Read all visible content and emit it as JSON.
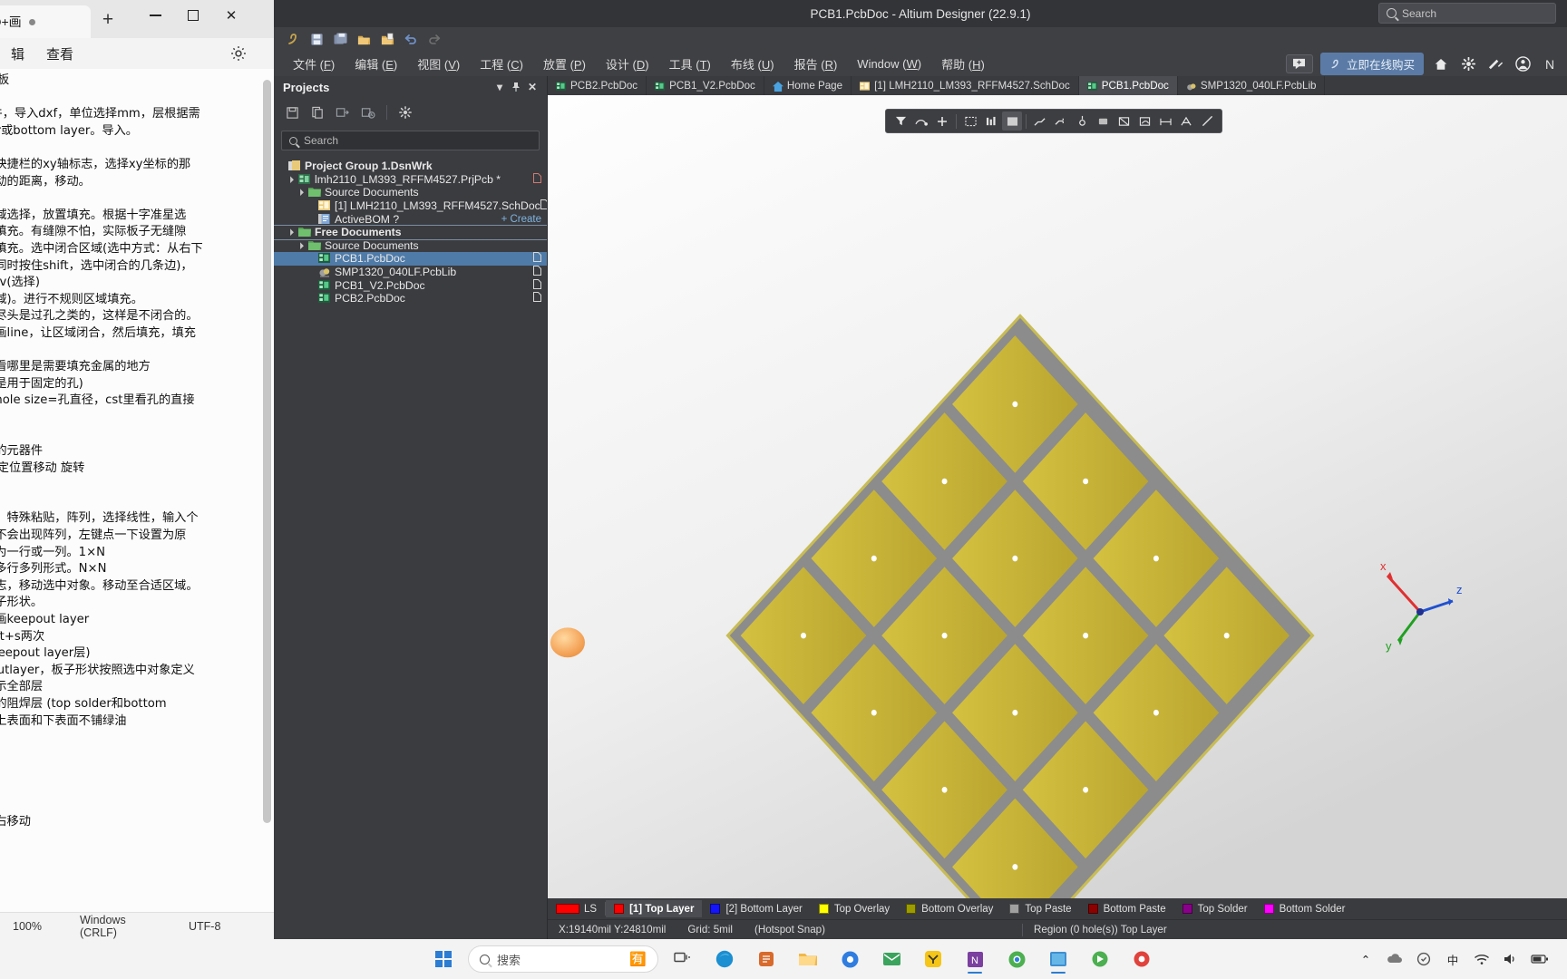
{
  "editor": {
    "tab_title": "入AD+画",
    "new_tab_label": "+",
    "window_buttons": {
      "minimize": "—",
      "maximize": "▢",
      "close": "✕"
    },
    "menus": [
      "辑",
      "查看"
    ],
    "gear_icon": "gear-icon",
    "content": "emo板\n\nb文件，导入dxf，单位选择mm，层根据需\nlayer或bottom layer。导入。\n\n上方快捷栏的xy轴标志，选择xy坐标的那\n要移动的距离，移动。\n\n则区域选择，放置填充。根据十字准星选\n点，填充。有缝隙不怕，实际板子无缝隙\n区域填充。选中闭合区域(选中方式：从右下\n边，同时按住shift，选中闭合的几条边)，\n具)＋v(选择)\n择区域)。进行不规则区域填充。\n区域尽头是过孔之类的，这样是不闭合的。\n孔，画line，让区域闭合，然后填充，填充\n孔。\n井，看哪里是需要填充金属的地方\n一般是用于固定的孔)\n孔，hole size=孔直径，cst里看孔的直接\n\n\n要加的元器件\nxy固定位置移动 旋转\n\n\n编辑，特殊粘贴，阵列，选择线性，输入个\n离。不会出现阵列，左键点一下设置为原\n列，为一行或一列。1×N\n生成多行多列形式。N×N\n动标志，移动选中对象。移动至合适区域。\n置板子形状。\n边缘画keepout layer\n  shift+s两次\n层 (keepout layer层)\nep outlayer，板子形状按照选中对象定义\n，显示全部层\n底层的阻焊层 (top solder和bottom\n使得上表面和下表面不铺绿油\n\n\n\n移动\n\n：左右移动\n放大",
    "status": {
      "zoom": "100%",
      "line_ending": "Windows (CRLF)",
      "encoding": "UTF-8"
    }
  },
  "altium": {
    "title": "PCB1.PcbDoc - Altium Designer (22.9.1)",
    "search_placeholder": "Search",
    "quick_toolbar": [
      "altium-logo-icon",
      "save-icon",
      "save-all-icon",
      "open-icon",
      "open-project-icon",
      "undo-icon",
      "redo-icon"
    ],
    "menus": [
      {
        "label": "文件",
        "accel": "F"
      },
      {
        "label": "编辑",
        "accel": "E"
      },
      {
        "label": "视图",
        "accel": "V"
      },
      {
        "label": "工程",
        "accel": "C"
      },
      {
        "label": "放置",
        "accel": "P"
      },
      {
        "label": "设计",
        "accel": "D"
      },
      {
        "label": "工具",
        "accel": "T"
      },
      {
        "label": "布线",
        "accel": "U"
      },
      {
        "label": "报告",
        "accel": "R"
      },
      {
        "label": "Window",
        "accel": "W"
      },
      {
        "label": "帮助",
        "accel": "H"
      }
    ],
    "buy_button": "立即在线购买",
    "right_icons": [
      "chat-icon",
      "home-icon",
      "gear-icon",
      "notifications-icon",
      "account-icon",
      "menu-icon"
    ],
    "projects_panel": {
      "title": "Projects",
      "header_buttons": [
        "chevron-down-icon",
        "pin-icon",
        "close-icon"
      ],
      "toolbar_icons": [
        "save-icon",
        "copy-icon",
        "compile-icon",
        "history-icon",
        "settings-icon"
      ],
      "search_placeholder": "Search",
      "tree": [
        {
          "indent": 0,
          "arrow": "",
          "icon": "workspace-icon",
          "label": "Project Group 1.DsnWrk",
          "right": "",
          "bold": true,
          "selected": false,
          "boxed": false
        },
        {
          "indent": 1,
          "arrow": "▲",
          "icon": "pcb-project-icon",
          "label": "lmh2110_LM393_RFFM4527.PrjPcb *",
          "right": "doc-red",
          "bold": false,
          "selected": false,
          "boxed": false
        },
        {
          "indent": 2,
          "arrow": "▲",
          "icon": "folder-icon",
          "label": "Source Documents",
          "right": "",
          "bold": false,
          "selected": false,
          "boxed": false
        },
        {
          "indent": 3,
          "arrow": "",
          "icon": "sch-icon",
          "label": "[1] LMH2110_LM393_RFFM4527.SchDoc",
          "right": "doc",
          "bold": false,
          "selected": false,
          "boxed": false
        },
        {
          "indent": 3,
          "arrow": "",
          "icon": "bom-icon",
          "label": "ActiveBOM ?",
          "right": "+ Create",
          "bold": false,
          "selected": false,
          "boxed": false
        },
        {
          "indent": 1,
          "arrow": "▲",
          "icon": "folder-icon",
          "label": "Free Documents",
          "right": "",
          "bold": true,
          "selected": false,
          "boxed": true
        },
        {
          "indent": 2,
          "arrow": "▲",
          "icon": "folder-icon",
          "label": "Source Documents",
          "right": "",
          "bold": false,
          "selected": false,
          "boxed": false
        },
        {
          "indent": 3,
          "arrow": "",
          "icon": "pcb-icon",
          "label": "PCB1.PcbDoc",
          "right": "doc",
          "bold": false,
          "selected": true,
          "boxed": false
        },
        {
          "indent": 3,
          "arrow": "",
          "icon": "pcblib-icon",
          "label": "SMP1320_040LF.PcbLib",
          "right": "doc",
          "bold": false,
          "selected": false,
          "boxed": false
        },
        {
          "indent": 3,
          "arrow": "",
          "icon": "pcb-icon",
          "label": "PCB1_V2.PcbDoc",
          "right": "doc",
          "bold": false,
          "selected": false,
          "boxed": false
        },
        {
          "indent": 3,
          "arrow": "",
          "icon": "pcb-icon",
          "label": "PCB2.PcbDoc",
          "right": "doc",
          "bold": false,
          "selected": false,
          "boxed": false
        }
      ]
    },
    "doc_tabs": [
      {
        "label": "PCB2.PcbDoc",
        "icon": "pcb-icon",
        "active": false
      },
      {
        "label": "PCB1_V2.PcbDoc",
        "icon": "pcb-icon",
        "active": false
      },
      {
        "label": "Home Page",
        "icon": "home-icon",
        "active": false
      },
      {
        "label": "[1] LMH2110_LM393_RFFM4527.SchDoc",
        "icon": "sch-icon",
        "active": false
      },
      {
        "label": "PCB1.PcbDoc",
        "icon": "pcb-icon",
        "active": true
      },
      {
        "label": "SMP1320_040LF.PcbLib",
        "icon": "pcblib-icon",
        "active": false
      }
    ],
    "float_toolbar": [
      "filter-icon",
      "net-icon",
      "add-icon",
      "select-rect-icon",
      "align-icon",
      "fill-icon",
      "route-icon",
      "via-icon",
      "component-icon",
      "polygon-icon",
      "arc-icon",
      "dimension-icon",
      "text-icon",
      "line-icon"
    ],
    "layers": [
      {
        "label": "LS",
        "color": "#ff0000",
        "active": false,
        "isLS": true
      },
      {
        "label": "[1] Top Layer",
        "color": "#ff0000",
        "active": true
      },
      {
        "label": "[2] Bottom Layer",
        "color": "#1414ff",
        "active": false
      },
      {
        "label": "Top Overlay",
        "color": "#ffff00",
        "active": false
      },
      {
        "label": "Bottom Overlay",
        "color": "#9c9c00",
        "active": false
      },
      {
        "label": "Top Paste",
        "color": "#a0a0a0",
        "active": false
      },
      {
        "label": "Bottom Paste",
        "color": "#8c0000",
        "active": false
      },
      {
        "label": "Top Solder",
        "color": "#8b008b",
        "active": false
      },
      {
        "label": "Bottom Solder",
        "color": "#ff00ff",
        "active": false
      }
    ],
    "status": {
      "coords": "X:19140mil Y:24810mil",
      "grid": "Grid: 5mil",
      "snap": "(Hotspot Snap)",
      "selection": "Region (0 hole(s)) Top Layer"
    },
    "axis_labels": {
      "x": "x",
      "y": "y",
      "z": "z"
    }
  },
  "taskbar": {
    "search_placeholder": "搜索",
    "search_icon": "search-icon",
    "start_icon": "windows-start-icon",
    "apps": [
      "task-view-icon",
      "edge-icon",
      "store-icon",
      "explorer-icon",
      "browser-icon",
      "mail-icon",
      "yy-icon",
      "onenote-icon",
      "chrome-icon",
      "altium-icon",
      "misc-icon",
      "player-icon"
    ],
    "tray": {
      "chevron": "⌃",
      "ime": "中",
      "network": "wifi-icon",
      "volume": "volume-icon",
      "clock": ""
    }
  }
}
